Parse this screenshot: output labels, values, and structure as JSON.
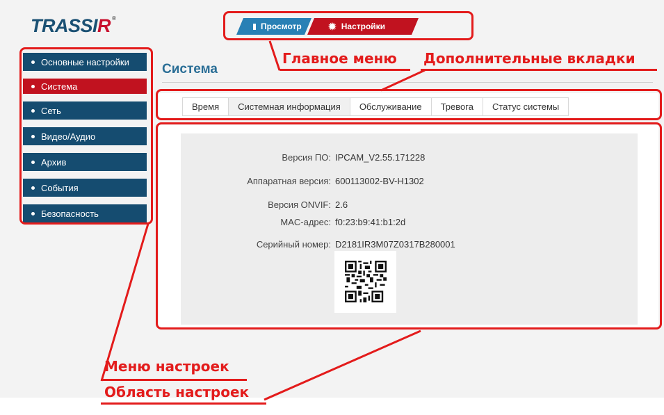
{
  "brand": {
    "logo_main": "TRASSI",
    "logo_accent": "R",
    "logo_mark": "®"
  },
  "main_menu": {
    "view_label": "Просмотр",
    "settings_label": "Настройки",
    "view_icon": "monitor-icon",
    "settings_icon": "gear-icon"
  },
  "sidebar": {
    "items": [
      {
        "label": "Основные настройки"
      },
      {
        "label": "Система"
      },
      {
        "label": "Сеть"
      },
      {
        "label": "Видео/Аудио"
      },
      {
        "label": "Архив"
      },
      {
        "label": "События"
      },
      {
        "label": "Безопасность"
      }
    ],
    "active_index": 1
  },
  "page": {
    "title": "Система"
  },
  "tabs": [
    {
      "label": "Время"
    },
    {
      "label": "Системная информация"
    },
    {
      "label": "Обслуживание"
    },
    {
      "label": "Тревога"
    },
    {
      "label": "Статус системы"
    }
  ],
  "active_tab": 1,
  "info": [
    {
      "label": "Версия ПО:",
      "value": "IPCAM_V2.55.171228"
    },
    {
      "label": "Аппаратная версия:",
      "value": "600113002-BV-H1302"
    },
    {
      "label": "Версия ONVIF:",
      "value": "2.6"
    },
    {
      "label": "MAC-адрес:",
      "value": "f0:23:b9:41:b1:2d"
    },
    {
      "label": "Серийный номер:",
      "value": "D2181IR3M07Z0317B280001"
    }
  ],
  "annotations": {
    "main_menu": "Главное меню",
    "extra_tabs": "Дополнительные вкладки",
    "settings_menu": "Меню настроек",
    "settings_area": "Область настроек"
  },
  "colors": {
    "brand_blue": "#1a5073",
    "accent_red": "#c1121f",
    "view_tab_blue": "#2880b5",
    "annotation_red": "#e31b1b",
    "title_blue": "#2a6e96"
  }
}
